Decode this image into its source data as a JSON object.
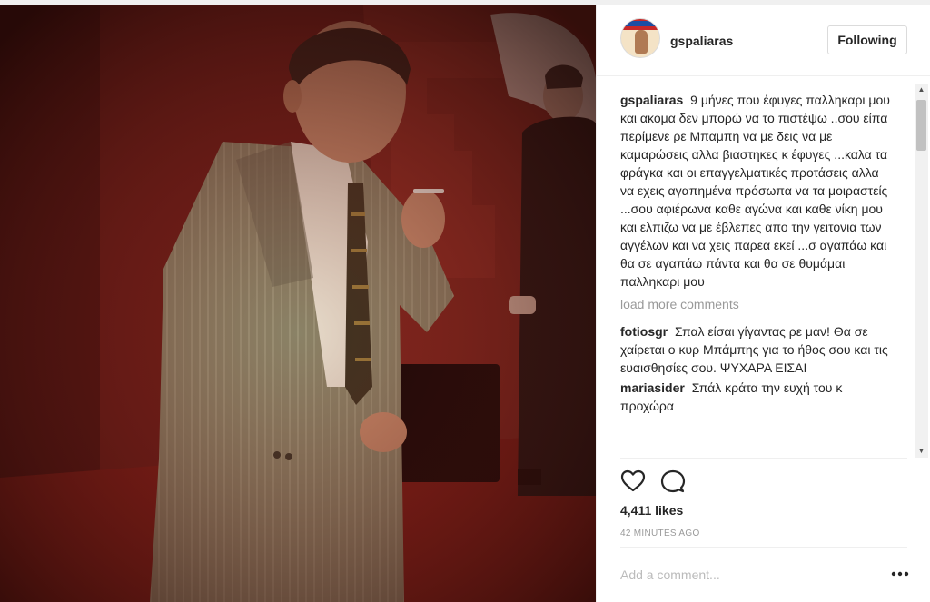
{
  "post": {
    "username": "gspaliaras",
    "follow_label": "Following",
    "likes": "4,411 likes",
    "time_ago": "42 MINUTES AGO",
    "add_comment_placeholder": "Add a comment...",
    "load_more_label": "load more comments"
  },
  "comments": [
    {
      "user": "gspaliaras",
      "text": "9 μήνες που έφυγες παλληκαρι μου και ακομα δεν μπορώ να το πιστέψω ..σου είπα περίμενε ρε Μπαμπη να με δεις να με καμαρώσεις αλλα βιαστηκες κ έφυγες ...καλα τα φράγκα και οι επαγγελματικές προτάσεις αλλα να εχεις αγαπημένα πρόσωπα να τα μοιραστείς ...σου αφιέρωνα καθε αγώνα και καθε νίκη μου και ελπιζω να με έβλεπες απο την γειτονια των αγγέλων και να χεις παρεα εκεί ...σ αγαπάω και θα σε αγαπάω πάντα και θα σε θυμάμαι παλληκαρι μου"
    },
    {
      "user": "fotiosgr",
      "text": "Σπαλ είσαι γίγαντας ρε μαν! Θα σε χαίρεται ο κυρ Μπάμπης για το ήθος σου και τις ευαισθησίες σου. ΨΥΧΑΡΑ ΕΙΣΑΙ"
    },
    {
      "user": "mariasider",
      "text": "Σπάλ κράτα την ευχή του κ προχώρα"
    }
  ],
  "icons": {
    "like": "heart-outline-icon",
    "comment": "speech-bubble-icon",
    "more": "ellipsis-icon",
    "scroll_up": "triangle-up",
    "scroll_down": "triangle-down"
  },
  "colors": {
    "text": "#262626",
    "muted": "#999999",
    "border": "#efefef",
    "photo_red": "#7a1f1a"
  }
}
